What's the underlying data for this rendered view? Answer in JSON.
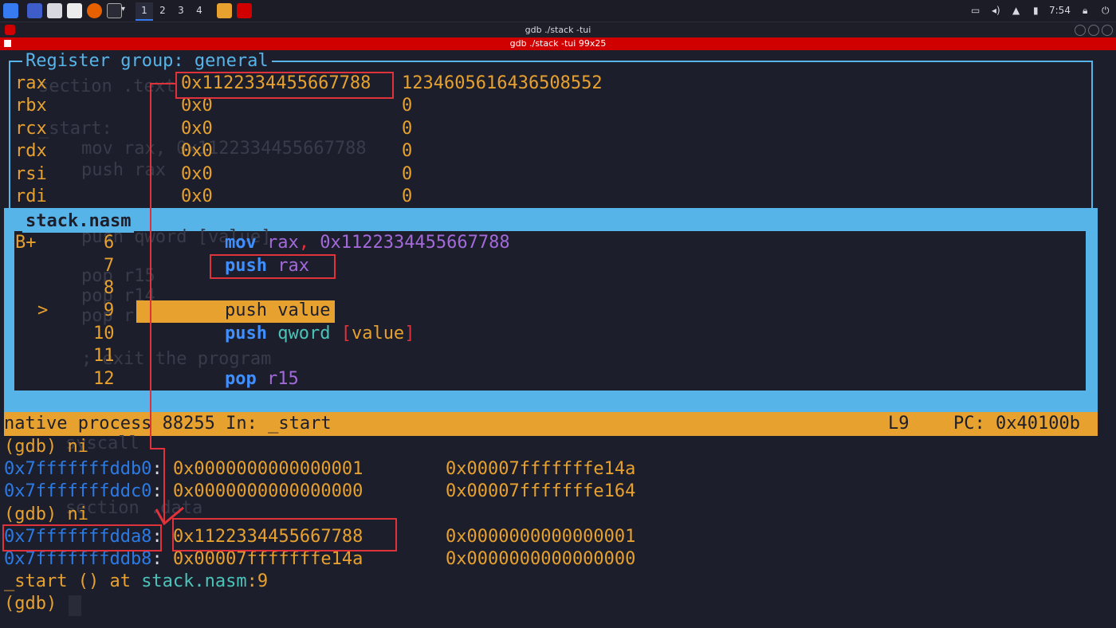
{
  "taskbar": {
    "workspaces": [
      "1",
      "2",
      "3",
      "4"
    ],
    "clock": "7:54"
  },
  "window": {
    "title": "gdb ./stack -tui",
    "tab_title": "gdb ./stack -tui 99x25"
  },
  "register_panel": {
    "title": "Register group: general",
    "rows": [
      {
        "name": "rax",
        "hex": "0x1122334455667788",
        "dec": "1234605616436508552"
      },
      {
        "name": "rbx",
        "hex": "0x0",
        "dec": "0"
      },
      {
        "name": "rcx",
        "hex": "0x0",
        "dec": "0"
      },
      {
        "name": "rdx",
        "hex": "0x0",
        "dec": "0"
      },
      {
        "name": "rsi",
        "hex": "0x0",
        "dec": "0"
      },
      {
        "name": "rdi",
        "hex": "0x0",
        "dec": "0"
      }
    ]
  },
  "source_panel": {
    "title": "stack.nasm",
    "breakpoint_marker": "B+",
    "current_marker": ">",
    "lines": [
      {
        "num": "6",
        "op": "mov",
        "rest1": " rax",
        "comma": ",",
        "rest2": " 0x1122334455667788"
      },
      {
        "num": "7",
        "op": "push",
        "rest1": " rax",
        "comma": "",
        "rest2": ""
      },
      {
        "num": "8",
        "op": "",
        "rest1": "",
        "comma": "",
        "rest2": ""
      },
      {
        "num": "9",
        "text": "push value"
      },
      {
        "num": "10",
        "op": "push",
        "rest1": " qword ",
        "lb": "[",
        "mid": "value",
        "rb": "]"
      },
      {
        "num": "11"
      },
      {
        "num": "12",
        "op": "pop",
        "rest1": " r",
        "rest2": "15"
      }
    ]
  },
  "status_bar": {
    "process": "native process 88255 In: _start",
    "line": "L9",
    "pc": "PC: 0x40100b"
  },
  "console": [
    {
      "type": "prompt",
      "text": "(gdb) ni"
    },
    {
      "type": "mem",
      "addr": "0x7fffffffddb0",
      "v1": "0x0000000000000001",
      "v2": "0x00007fffffffe14a"
    },
    {
      "type": "mem",
      "addr": "0x7fffffffddc0",
      "v1": "0x0000000000000000",
      "v2": "0x00007fffffffe164"
    },
    {
      "type": "prompt",
      "text": "(gdb) ni"
    },
    {
      "type": "mem",
      "addr": "0x7fffffffdda8",
      "v1": "0x1122334455667788",
      "v2": "0x0000000000000001"
    },
    {
      "type": "mem",
      "addr": "0x7fffffffddb8",
      "v1": "0x00007fffffffe14a",
      "v2": "0x0000000000000000"
    },
    {
      "type": "frame",
      "fn": "_start () at ",
      "file": "stack.nasm",
      "line": ":9"
    },
    {
      "type": "prompt",
      "text": "(gdb)"
    }
  ],
  "ghost_text": [
    "section .text",
    "_start:",
    "mov rax, 0x1122334455667788",
    "push rax",
    "push qword [value]",
    "pop r15",
    "pop r14",
    "pop r13",
    "; exit the program",
    "syscall",
    "section .data"
  ]
}
